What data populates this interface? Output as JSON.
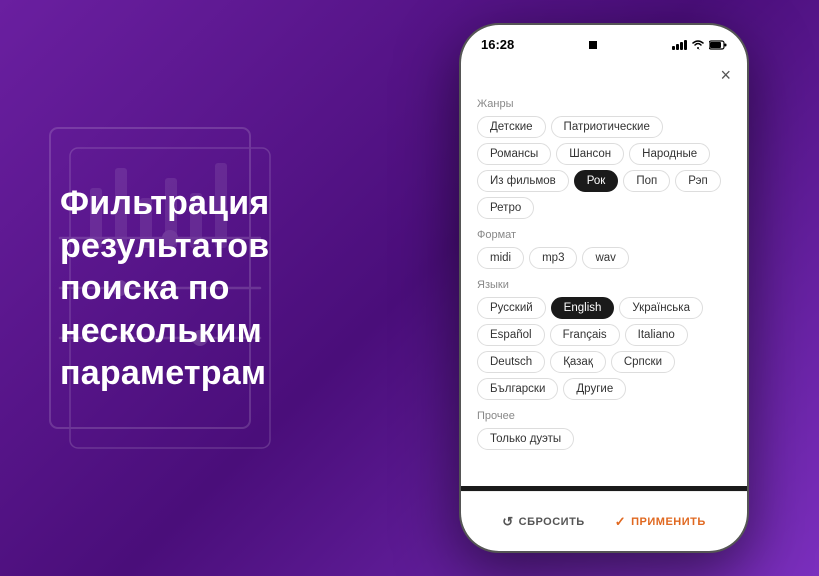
{
  "background": {
    "gradient_start": "#6a1fa0",
    "gradient_end": "#4a0e7a"
  },
  "left": {
    "title": "Фильтрация результатов поиска по нескольким параметрам"
  },
  "phone": {
    "status_bar": {
      "time": "16:28"
    },
    "close_button_label": "×",
    "sections": [
      {
        "id": "genres",
        "label": "Жанры",
        "tags": [
          {
            "text": "Детские",
            "active": false
          },
          {
            "text": "Патриотические",
            "active": false
          },
          {
            "text": "Романсы",
            "active": false
          },
          {
            "text": "Шансон",
            "active": false
          },
          {
            "text": "Народные",
            "active": false
          },
          {
            "text": "Из фильмов",
            "active": false
          },
          {
            "text": "Рок",
            "active": true
          },
          {
            "text": "Поп",
            "active": false
          },
          {
            "text": "Рэп",
            "active": false
          },
          {
            "text": "Ретро",
            "active": false
          }
        ]
      },
      {
        "id": "format",
        "label": "Формат",
        "tags": [
          {
            "text": "midi",
            "active": false
          },
          {
            "text": "mp3",
            "active": false
          },
          {
            "text": "wav",
            "active": false
          }
        ]
      },
      {
        "id": "languages",
        "label": "Языки",
        "tags": [
          {
            "text": "Русский",
            "active": false
          },
          {
            "text": "English",
            "active": true
          },
          {
            "text": "Українська",
            "active": false
          },
          {
            "text": "Español",
            "active": false
          },
          {
            "text": "Français",
            "active": false
          },
          {
            "text": "Italiano",
            "active": false
          },
          {
            "text": "Deutsch",
            "active": false
          },
          {
            "text": "Қазақ",
            "active": false
          },
          {
            "text": "Српски",
            "active": false
          },
          {
            "text": "Български",
            "active": false
          },
          {
            "text": "Другие",
            "active": false
          }
        ]
      },
      {
        "id": "other",
        "label": "Прочее",
        "tags": [
          {
            "text": "Только дуэты",
            "active": false
          }
        ]
      }
    ],
    "bottom": {
      "reset_label": "СБРОСИТЬ",
      "apply_label": "ПРИМЕНИТЬ"
    }
  }
}
